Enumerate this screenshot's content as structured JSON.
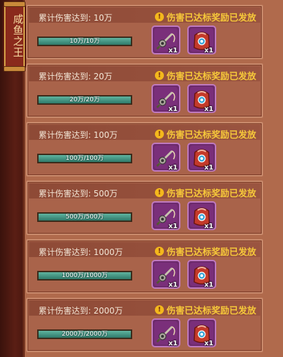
{
  "side_tag": {
    "label": "咸鱼之王"
  },
  "rows": [
    {
      "requirement": "累计伤害达到: 10万",
      "status": "伤害已达标奖励已发放",
      "progress_text": "10万/10万",
      "progress": 1.0,
      "rewards": [
        {
          "icon": "fishing-rod-icon",
          "qty": "x1"
        },
        {
          "icon": "red-bag-icon",
          "qty": "x1"
        }
      ]
    },
    {
      "requirement": "累计伤害达到: 20万",
      "status": "伤害已达标奖励已发放",
      "progress_text": "20万/20万",
      "progress": 1.0,
      "rewards": [
        {
          "icon": "fishing-rod-icon",
          "qty": "x1"
        },
        {
          "icon": "red-bag-icon",
          "qty": "x1"
        }
      ]
    },
    {
      "requirement": "累计伤害达到: 100万",
      "status": "伤害已达标奖励已发放",
      "progress_text": "100万/100万",
      "progress": 1.0,
      "rewards": [
        {
          "icon": "fishing-rod-icon",
          "qty": "x1"
        },
        {
          "icon": "red-bag-icon",
          "qty": "x1"
        }
      ]
    },
    {
      "requirement": "累计伤害达到: 500万",
      "status": "伤害已达标奖励已发放",
      "progress_text": "500万/500万",
      "progress": 1.0,
      "rewards": [
        {
          "icon": "fishing-rod-icon",
          "qty": "x1"
        },
        {
          "icon": "red-bag-icon",
          "qty": "x1"
        }
      ]
    },
    {
      "requirement": "累计伤害达到: 1000万",
      "status": "伤害已达标奖励已发放",
      "progress_text": "1000万/1000万",
      "progress": 1.0,
      "rewards": [
        {
          "icon": "fishing-rod-icon",
          "qty": "x1"
        },
        {
          "icon": "red-bag-icon",
          "qty": "x1"
        }
      ]
    },
    {
      "requirement": "累计伤害达到: 2000万",
      "status": "伤害已达标奖励已发放",
      "progress_text": "2000万/2000万",
      "progress": 1.0,
      "rewards": [
        {
          "icon": "fishing-rod-icon",
          "qty": "x1"
        },
        {
          "icon": "red-bag-icon",
          "qty": "x1"
        }
      ]
    }
  ],
  "colors": {
    "progress_fill": "#3f8f7c",
    "status_text": "#f6c83a",
    "item_frame": "#6c2a6c"
  }
}
